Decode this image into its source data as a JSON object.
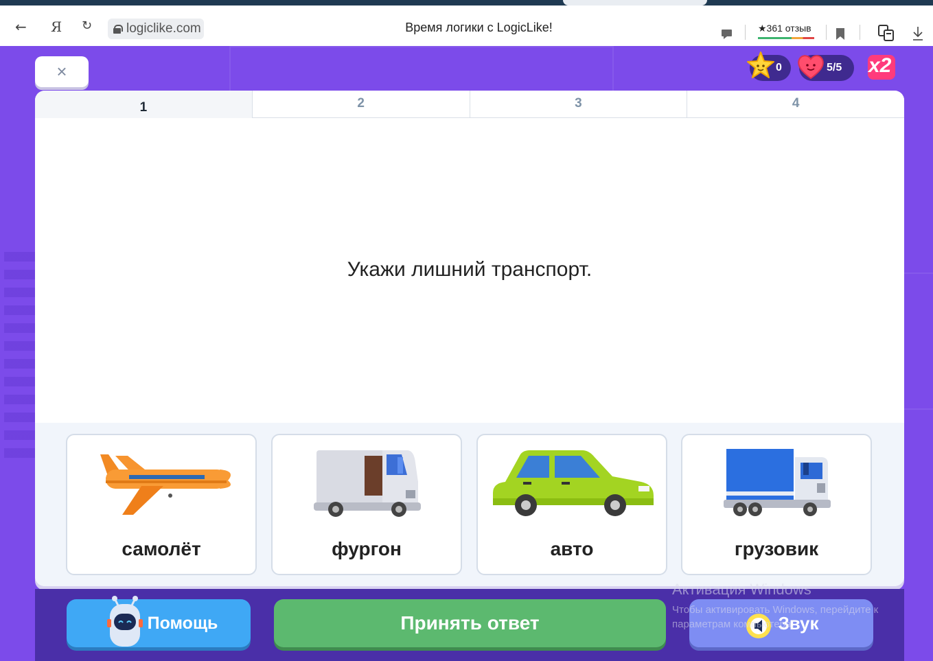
{
  "browser": {
    "url": "logiclike.com",
    "page_title": "Время логики с LogicLike!",
    "reviews": "★361 отзыв",
    "back_icon": "arrow-left-icon",
    "yandex_icon": "yandex-logo-icon",
    "reload_icon": "reload-icon"
  },
  "hud": {
    "stars": "0",
    "lives": "5/5",
    "multiplier": "x2"
  },
  "close_button": "×",
  "tabs": [
    {
      "label": "1",
      "active": true
    },
    {
      "label": "2",
      "active": false
    },
    {
      "label": "3",
      "active": false
    },
    {
      "label": "4",
      "active": false
    }
  ],
  "question": "Укажи лишний транспорт.",
  "options": [
    {
      "label": "самолёт",
      "icon": "airplane-icon"
    },
    {
      "label": "фургон",
      "icon": "van-icon"
    },
    {
      "label": "авто",
      "icon": "car-icon"
    },
    {
      "label": "грузовик",
      "icon": "truck-icon"
    }
  ],
  "buttons": {
    "help": "Помощь",
    "accept": "Принять ответ",
    "sound": "Звук"
  },
  "watermark": {
    "title": "Активация Windows",
    "subtitle": "Чтобы активировать Windows, перейдите к параметрам компьютера."
  },
  "colors": {
    "brand_purple": "#7c4bea",
    "accept_green": "#5cb96f",
    "help_blue": "#3fa8f5",
    "sound_blue": "#7e8df3",
    "multiplier_pink": "#ff3b7c"
  }
}
